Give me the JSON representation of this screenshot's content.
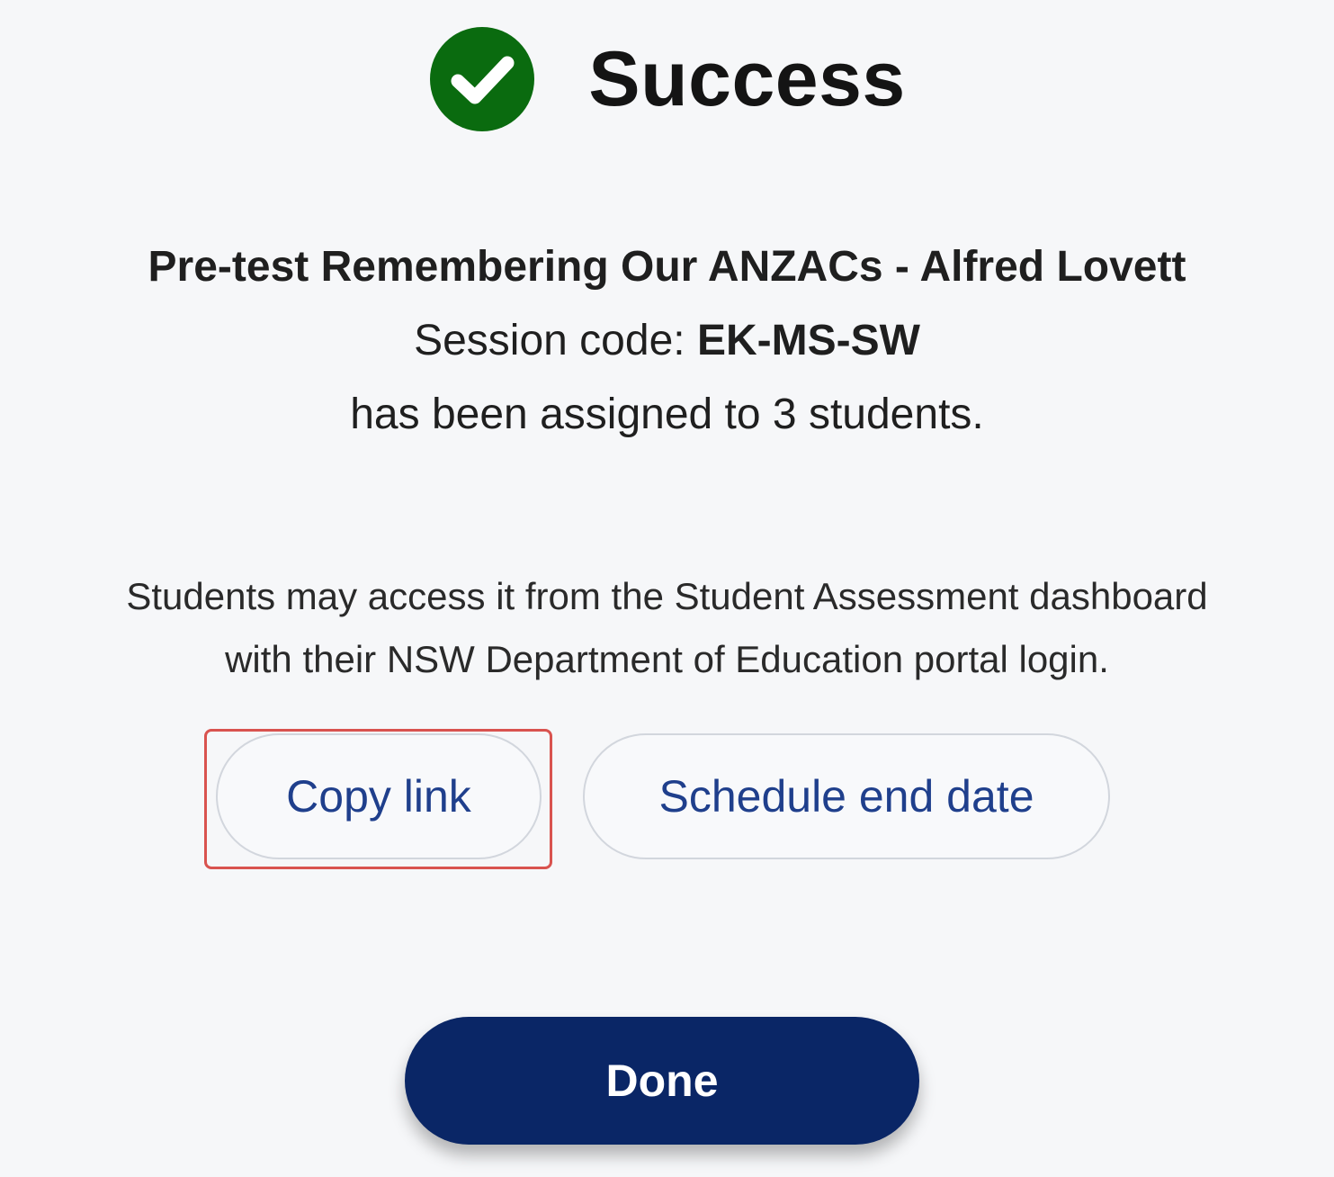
{
  "dialog": {
    "title": "Success",
    "icon": "check-circle-icon",
    "success_color": "#0a6b0f",
    "assessment_name": "Pre-test Remembering Our ANZACs - Alfred Lovett",
    "session_code_label": "Session code: ",
    "session_code_value": "EK-MS-SW",
    "assigned_text": "has been assigned to 3 students.",
    "info_line1": "Students may access it from the Student Assessment dashboard",
    "info_line2": "with their NSW Department of Education portal login.",
    "buttons": {
      "copy_link": "Copy link",
      "schedule_end_date": "Schedule end date",
      "done": "Done"
    },
    "colors": {
      "primary": "#0a2666",
      "link": "#1f3f8c",
      "highlight": "#d9534f"
    }
  }
}
